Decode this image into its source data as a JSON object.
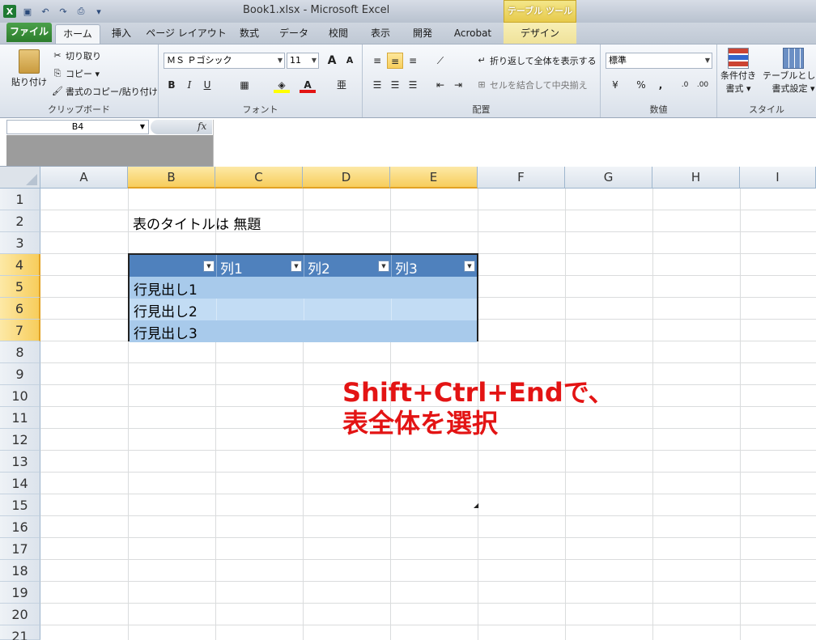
{
  "title_bar": {
    "doc_title": "Book1.xlsx  -  Microsoft Excel",
    "context_group": "テーブル ツール",
    "qat_icons": [
      "excel-logo-icon",
      "save-icon",
      "undo-icon",
      "redo-icon",
      "print-preview-icon",
      "customize-icon"
    ]
  },
  "tabs": {
    "file": "ファイル",
    "home": "ホーム",
    "insert": "挿入",
    "page_layout": "ページ レイアウト",
    "formulas": "数式",
    "data": "データ",
    "review": "校閲",
    "view": "表示",
    "developer": "開発",
    "acrobat": "Acrobat",
    "design": "デザイン"
  },
  "ribbon": {
    "clipboard": {
      "paste": "貼り付け",
      "cut": "切り取り",
      "copy": "コピー ▾",
      "format_painter": "書式のコピー/貼り付け",
      "label": "クリップボード"
    },
    "font": {
      "font_name": "ＭＳ Ｐゴシック",
      "font_size": "11",
      "grow": "A",
      "shrink": "A",
      "bold": "B",
      "italic": "I",
      "underline": "U",
      "label": "フォント"
    },
    "alignment": {
      "wrap_text": "折り返して全体を表示する",
      "merge_center": "セルを結合して中央揃え",
      "label": "配置"
    },
    "number": {
      "format": "標準",
      "percent": "%",
      "comma": ",",
      "label": "数値"
    },
    "styles": {
      "conditional": "条件付き",
      "conditional2": "書式 ▾",
      "format_table": "テーブルとして",
      "format_table2": "書式設定 ▾",
      "label": "スタイル"
    }
  },
  "formula_bar": {
    "name_box": "B4",
    "fx": "fx",
    "formula": ""
  },
  "columns": [
    "A",
    "B",
    "C",
    "D",
    "E",
    "F",
    "G",
    "H",
    "I"
  ],
  "rows": [
    "1",
    "2",
    "3",
    "4",
    "5",
    "6",
    "7",
    "8",
    "9",
    "10",
    "11",
    "12",
    "13",
    "14",
    "15",
    "16",
    "17",
    "18",
    "19",
    "20",
    "21"
  ],
  "cells": {
    "B2": "表のタイトルは 無題"
  },
  "table": {
    "headers": [
      "",
      "列1",
      "列2",
      "列3"
    ],
    "rows": [
      "行見出し1",
      "行見出し2",
      "行見出し3"
    ],
    "colors": {
      "header": "#4f81bd",
      "band1": "#a8caeb",
      "band2": "#c2dcf4"
    }
  },
  "annotation": {
    "line1": "Shift+Ctrl+Endで、",
    "line2": "表全体を選択",
    "color": "#e31414"
  }
}
